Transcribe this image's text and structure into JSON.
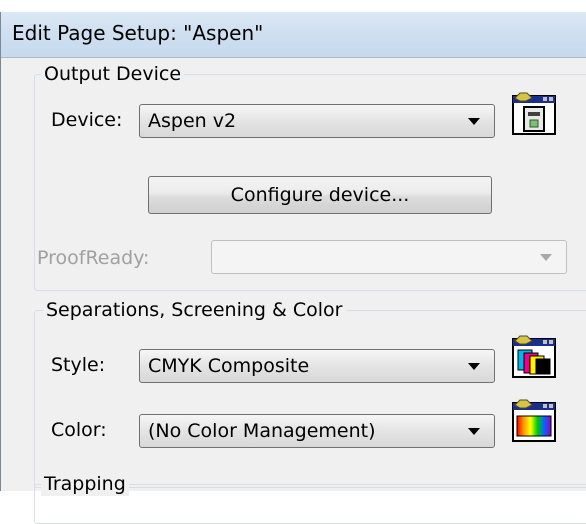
{
  "window": {
    "title": "Edit Page Setup: \"Aspen\""
  },
  "output_device": {
    "legend": "Output Device",
    "device_label": "Device:",
    "device_value": "Aspen v2",
    "configure_button": "Configure device...",
    "proofready_label": "ProofReady:",
    "proofready_value": ""
  },
  "separations": {
    "legend": "Separations, Screening & Color",
    "style_label": "Style:",
    "style_value": "CMYK Composite",
    "color_label": "Color:",
    "color_value": "(No Color Management)"
  },
  "trapping": {
    "legend": "Trapping"
  },
  "icons": {
    "device_properties": "device-properties-icon",
    "style_properties": "separation-style-properties-icon",
    "color_properties": "color-management-properties-icon"
  }
}
